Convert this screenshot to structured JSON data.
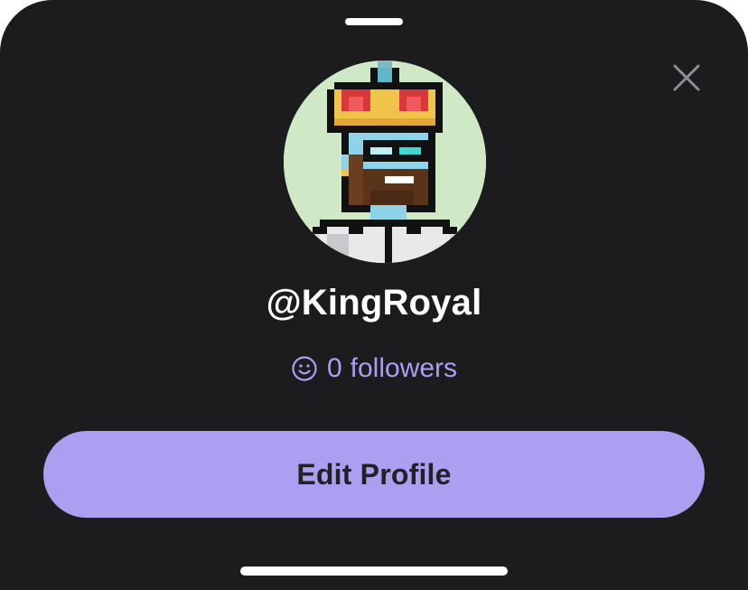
{
  "profile": {
    "username": "@KingRoyal",
    "follower_count": "0",
    "follower_label": "followers",
    "avatar_icon": "pixel-king-avatar",
    "avatar_bg_color": "#cfe9c6"
  },
  "actions": {
    "edit_profile_label": "Edit Profile",
    "close_icon": "close-icon"
  },
  "colors": {
    "sheet_bg": "#1c1b1d",
    "accent": "#ab9ff2",
    "button_text": "#222225",
    "username_text": "#ffffff"
  }
}
